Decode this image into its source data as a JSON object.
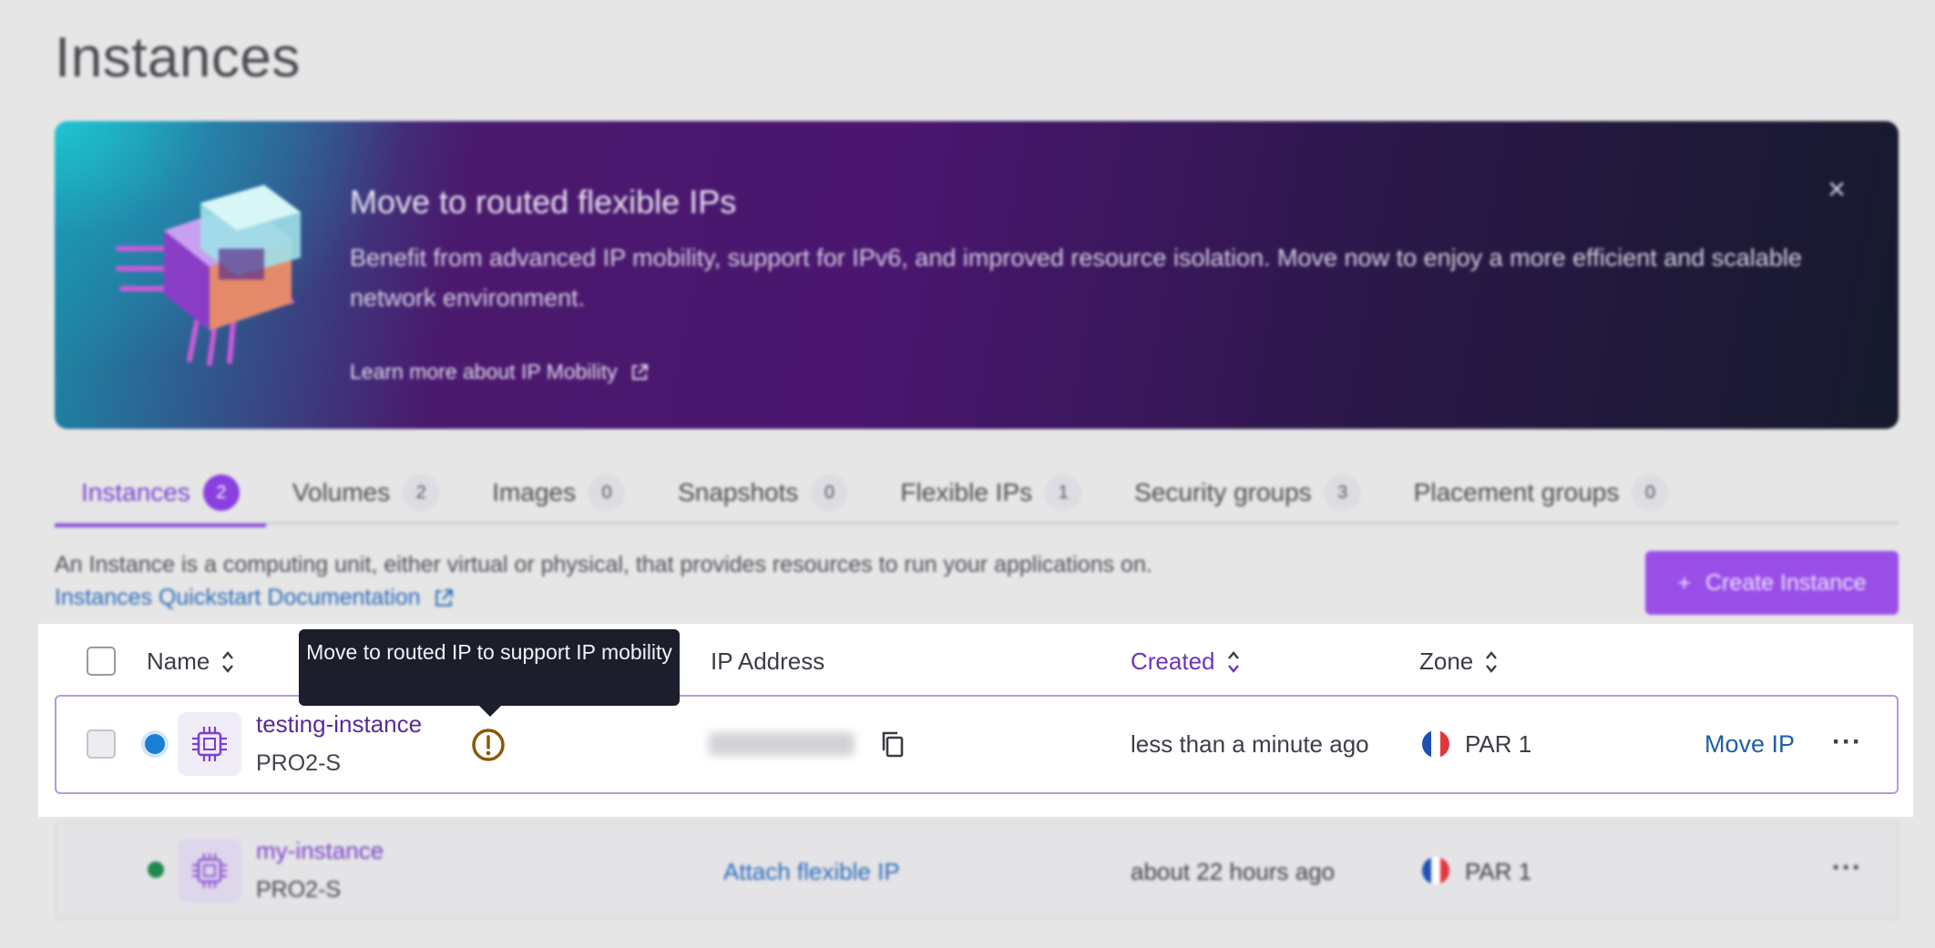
{
  "page": {
    "title": "Instances"
  },
  "banner": {
    "title": "Move to routed flexible IPs",
    "description": "Benefit from advanced IP mobility, support for IPv6, and improved resource isolation. Move now to enjoy a more efficient and scalable network environment.",
    "link_label": "Learn more about IP Mobility",
    "close_label": "×"
  },
  "tabs": [
    {
      "label": "Instances",
      "count": "2"
    },
    {
      "label": "Volumes",
      "count": "2"
    },
    {
      "label": "Images",
      "count": "0"
    },
    {
      "label": "Snapshots",
      "count": "0"
    },
    {
      "label": "Flexible IPs",
      "count": "1"
    },
    {
      "label": "Security groups",
      "count": "3"
    },
    {
      "label": "Placement groups",
      "count": "0"
    }
  ],
  "intro": {
    "text": "An Instance is a computing unit, either virtual or physical, that provides resources to run your applications on.",
    "doc_link": "Instances Quickstart Documentation"
  },
  "create_button": {
    "label": "Create Instance",
    "icon": "+"
  },
  "table": {
    "headers": {
      "name": "Name",
      "ip": "IP Address",
      "created": "Created",
      "zone": "Zone"
    },
    "rows": [
      {
        "name": "testing-instance",
        "type": "PRO2-S",
        "status_color": "#1b7fd6",
        "created": "less than a minute ago",
        "zone": "PAR 1",
        "action": "Move IP"
      },
      {
        "name": "my-instance",
        "type": "PRO2-S",
        "status_color": "#1e8a4e",
        "ip_action": "Attach flexible IP",
        "created": "about 22 hours ago",
        "zone": "PAR 1"
      }
    ]
  },
  "tooltip": {
    "text": "Move to routed IP to support IP mobility"
  },
  "more_label": "···"
}
